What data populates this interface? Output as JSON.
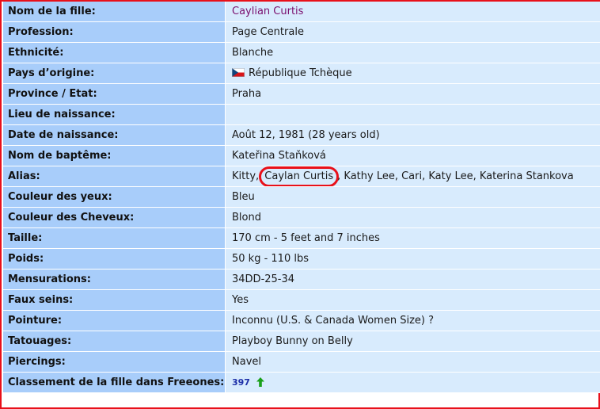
{
  "bio": {
    "name": {
      "label": "Nom de la fille:",
      "value": "Caylian Curtis"
    },
    "profession": {
      "label": "Profession:",
      "value": "Page Centrale"
    },
    "ethnicity": {
      "label": "Ethnicité:",
      "value": "Blanche"
    },
    "country": {
      "label": "Pays d’origine:",
      "value": "République Tchèque",
      "flag_icon": "czech-flag-icon"
    },
    "province": {
      "label": "Province / Etat:",
      "value": "Praha"
    },
    "birthplace": {
      "label": "Lieu de naissance:",
      "value": ""
    },
    "birthdate": {
      "label": "Date de naissance:",
      "value": "Août 12, 1981 (28 years old)"
    },
    "birth_name": {
      "label": "Nom de baptême:",
      "value": "Kateřina Staňková"
    },
    "alias": {
      "label": "Alias:",
      "prefix": "Kitty, ",
      "highlighted": "Caylan Curtis",
      "suffix": ", Kathy Lee, Cari, Katy Lee, Katerina Stankova"
    },
    "eye_color": {
      "label": "Couleur des yeux:",
      "value": "Bleu"
    },
    "hair_color": {
      "label": "Couleur des Cheveux:",
      "value": "Blond"
    },
    "height": {
      "label": "Taille:",
      "value": "170 cm - 5 feet and 7 inches"
    },
    "weight": {
      "label": "Poids:",
      "value": "50 kg - 110 lbs"
    },
    "measurements": {
      "label": "Mensurations:",
      "value": "34DD-25-34"
    },
    "fake_boobs": {
      "label": "Faux seins:",
      "value": "Yes"
    },
    "shoe_size": {
      "label": "Pointure:",
      "value": "Inconnu (U.S. & Canada Women Size) ?"
    },
    "tattoos": {
      "label": "Tatouages:",
      "value": "Playboy Bunny on Belly"
    },
    "piercings": {
      "label": "Piercings:",
      "value": "Navel"
    },
    "rank": {
      "label": "Classement de la fille dans Freeones:",
      "value": "397",
      "trend_icon": "green-up-arrow-icon"
    }
  },
  "colors": {
    "label_bg": "#a8cdfa",
    "value_bg": "#d8ebfd",
    "frame_border": "#e8101a",
    "name_link": "#7a0e6e",
    "rank_number": "#1d2fa8",
    "trend_arrow": "#1aa01a"
  }
}
